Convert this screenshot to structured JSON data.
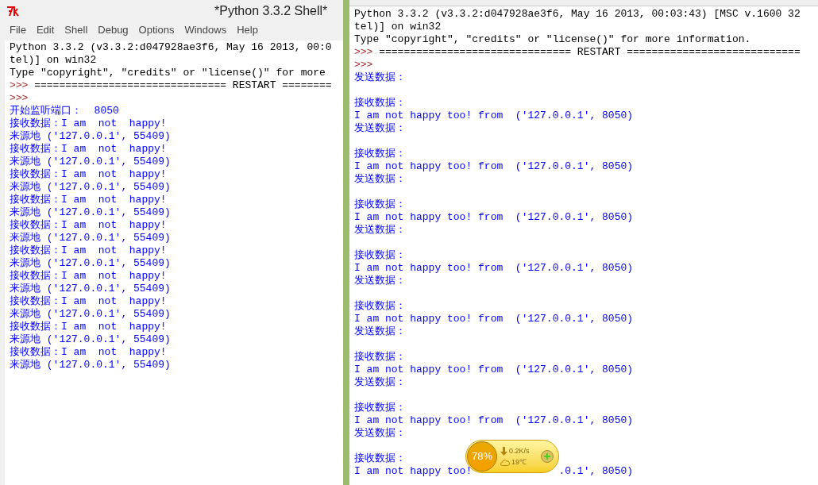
{
  "left_window": {
    "title": "*Python 3.3.2 Shell*",
    "menu": [
      "File",
      "Edit",
      "Shell",
      "Debug",
      "Options",
      "Windows",
      "Help"
    ],
    "lines": [
      {
        "kind": "console",
        "text": "Python 3.3.2 (v3.3.2:d047928ae3f6, May 16 2013, 00:0"
      },
      {
        "kind": "console",
        "text": "tel)] on win32"
      },
      {
        "kind": "console",
        "text": "Type \"copyright\", \"credits\" or \"license()\" for more"
      },
      {
        "kind": "prompt",
        "prompt": ">>>",
        "text": " =============================== RESTART ========"
      },
      {
        "kind": "prompt",
        "prompt": ">>>"
      },
      {
        "kind": "stdout",
        "text": "开始监听端口：  8050"
      },
      {
        "kind": "stdout",
        "text": "接收数据：I am  not  happy!"
      },
      {
        "kind": "stdout",
        "text": "来源地 ('127.0.0.1', 55409)"
      },
      {
        "kind": "stdout",
        "text": "接收数据：I am  not  happy!"
      },
      {
        "kind": "stdout",
        "text": "来源地 ('127.0.0.1', 55409)"
      },
      {
        "kind": "stdout",
        "text": "接收数据：I am  not  happy!"
      },
      {
        "kind": "stdout",
        "text": "来源地 ('127.0.0.1', 55409)"
      },
      {
        "kind": "stdout",
        "text": "接收数据：I am  not  happy!"
      },
      {
        "kind": "stdout",
        "text": "来源地 ('127.0.0.1', 55409)"
      },
      {
        "kind": "stdout",
        "text": "接收数据：I am  not  happy!"
      },
      {
        "kind": "stdout",
        "text": "来源地 ('127.0.0.1', 55409)"
      },
      {
        "kind": "stdout",
        "text": "接收数据：I am  not  happy!"
      },
      {
        "kind": "stdout",
        "text": "来源地 ('127.0.0.1', 55409)"
      },
      {
        "kind": "stdout",
        "text": "接收数据：I am  not  happy!"
      },
      {
        "kind": "stdout",
        "text": "来源地 ('127.0.0.1', 55409)"
      },
      {
        "kind": "stdout",
        "text": "接收数据：I am  not  happy!"
      },
      {
        "kind": "stdout",
        "text": "来源地 ('127.0.0.1', 55409)"
      },
      {
        "kind": "stdout",
        "text": "接收数据：I am  not  happy!"
      },
      {
        "kind": "stdout",
        "text": "来源地 ('127.0.0.1', 55409)"
      },
      {
        "kind": "stdout",
        "text": "接收数据：I am  not  happy!"
      },
      {
        "kind": "stdout",
        "text": "来源地 ('127.0.0.1', 55409)"
      }
    ]
  },
  "right_window": {
    "lines": [
      {
        "kind": "console",
        "text": "Python 3.3.2 (v3.3.2:d047928ae3f6, May 16 2013, 00:03:43) [MSC v.1600 32"
      },
      {
        "kind": "console",
        "text": "tel)] on win32"
      },
      {
        "kind": "console",
        "text": "Type \"copyright\", \"credits\" or \"license()\" for more information."
      },
      {
        "kind": "prompt",
        "prompt": ">>>",
        "text": " =============================== RESTART ============================"
      },
      {
        "kind": "prompt",
        "prompt": ">>>"
      },
      {
        "kind": "stdout",
        "text": "发送数据："
      },
      {
        "kind": "blank"
      },
      {
        "kind": "stdout",
        "text": "接收数据："
      },
      {
        "kind": "stdout",
        "text": "I am not happy too! from  ('127.0.0.1', 8050)"
      },
      {
        "kind": "stdout",
        "text": "发送数据："
      },
      {
        "kind": "blank"
      },
      {
        "kind": "stdout",
        "text": "接收数据："
      },
      {
        "kind": "stdout",
        "text": "I am not happy too! from  ('127.0.0.1', 8050)"
      },
      {
        "kind": "stdout",
        "text": "发送数据："
      },
      {
        "kind": "blank"
      },
      {
        "kind": "stdout",
        "text": "接收数据："
      },
      {
        "kind": "stdout",
        "text": "I am not happy too! from  ('127.0.0.1', 8050)"
      },
      {
        "kind": "stdout",
        "text": "发送数据："
      },
      {
        "kind": "blank"
      },
      {
        "kind": "stdout",
        "text": "接收数据："
      },
      {
        "kind": "stdout",
        "text": "I am not happy too! from  ('127.0.0.1', 8050)"
      },
      {
        "kind": "stdout",
        "text": "发送数据："
      },
      {
        "kind": "blank"
      },
      {
        "kind": "stdout",
        "text": "接收数据："
      },
      {
        "kind": "stdout",
        "text": "I am not happy too! from  ('127.0.0.1', 8050)"
      },
      {
        "kind": "stdout",
        "text": "发送数据："
      },
      {
        "kind": "blank"
      },
      {
        "kind": "stdout",
        "text": "接收数据："
      },
      {
        "kind": "stdout",
        "text": "I am not happy too! from  ('127.0.0.1', 8050)"
      },
      {
        "kind": "stdout",
        "text": "发送数据："
      },
      {
        "kind": "blank"
      },
      {
        "kind": "stdout",
        "text": "接收数据："
      },
      {
        "kind": "stdout",
        "text": "I am not happy too! from  ('127.0.0.1', 8050)"
      },
      {
        "kind": "stdout",
        "text": "发送数据："
      },
      {
        "kind": "blank"
      },
      {
        "kind": "stdout",
        "text": "接收数据："
      },
      {
        "kind": "stdout",
        "text": "I am not happy too!              .0.1', 8050)"
      }
    ]
  },
  "speed_ball": {
    "memory": "78%",
    "speed": "0.2K/s",
    "temperature": "19℃"
  }
}
